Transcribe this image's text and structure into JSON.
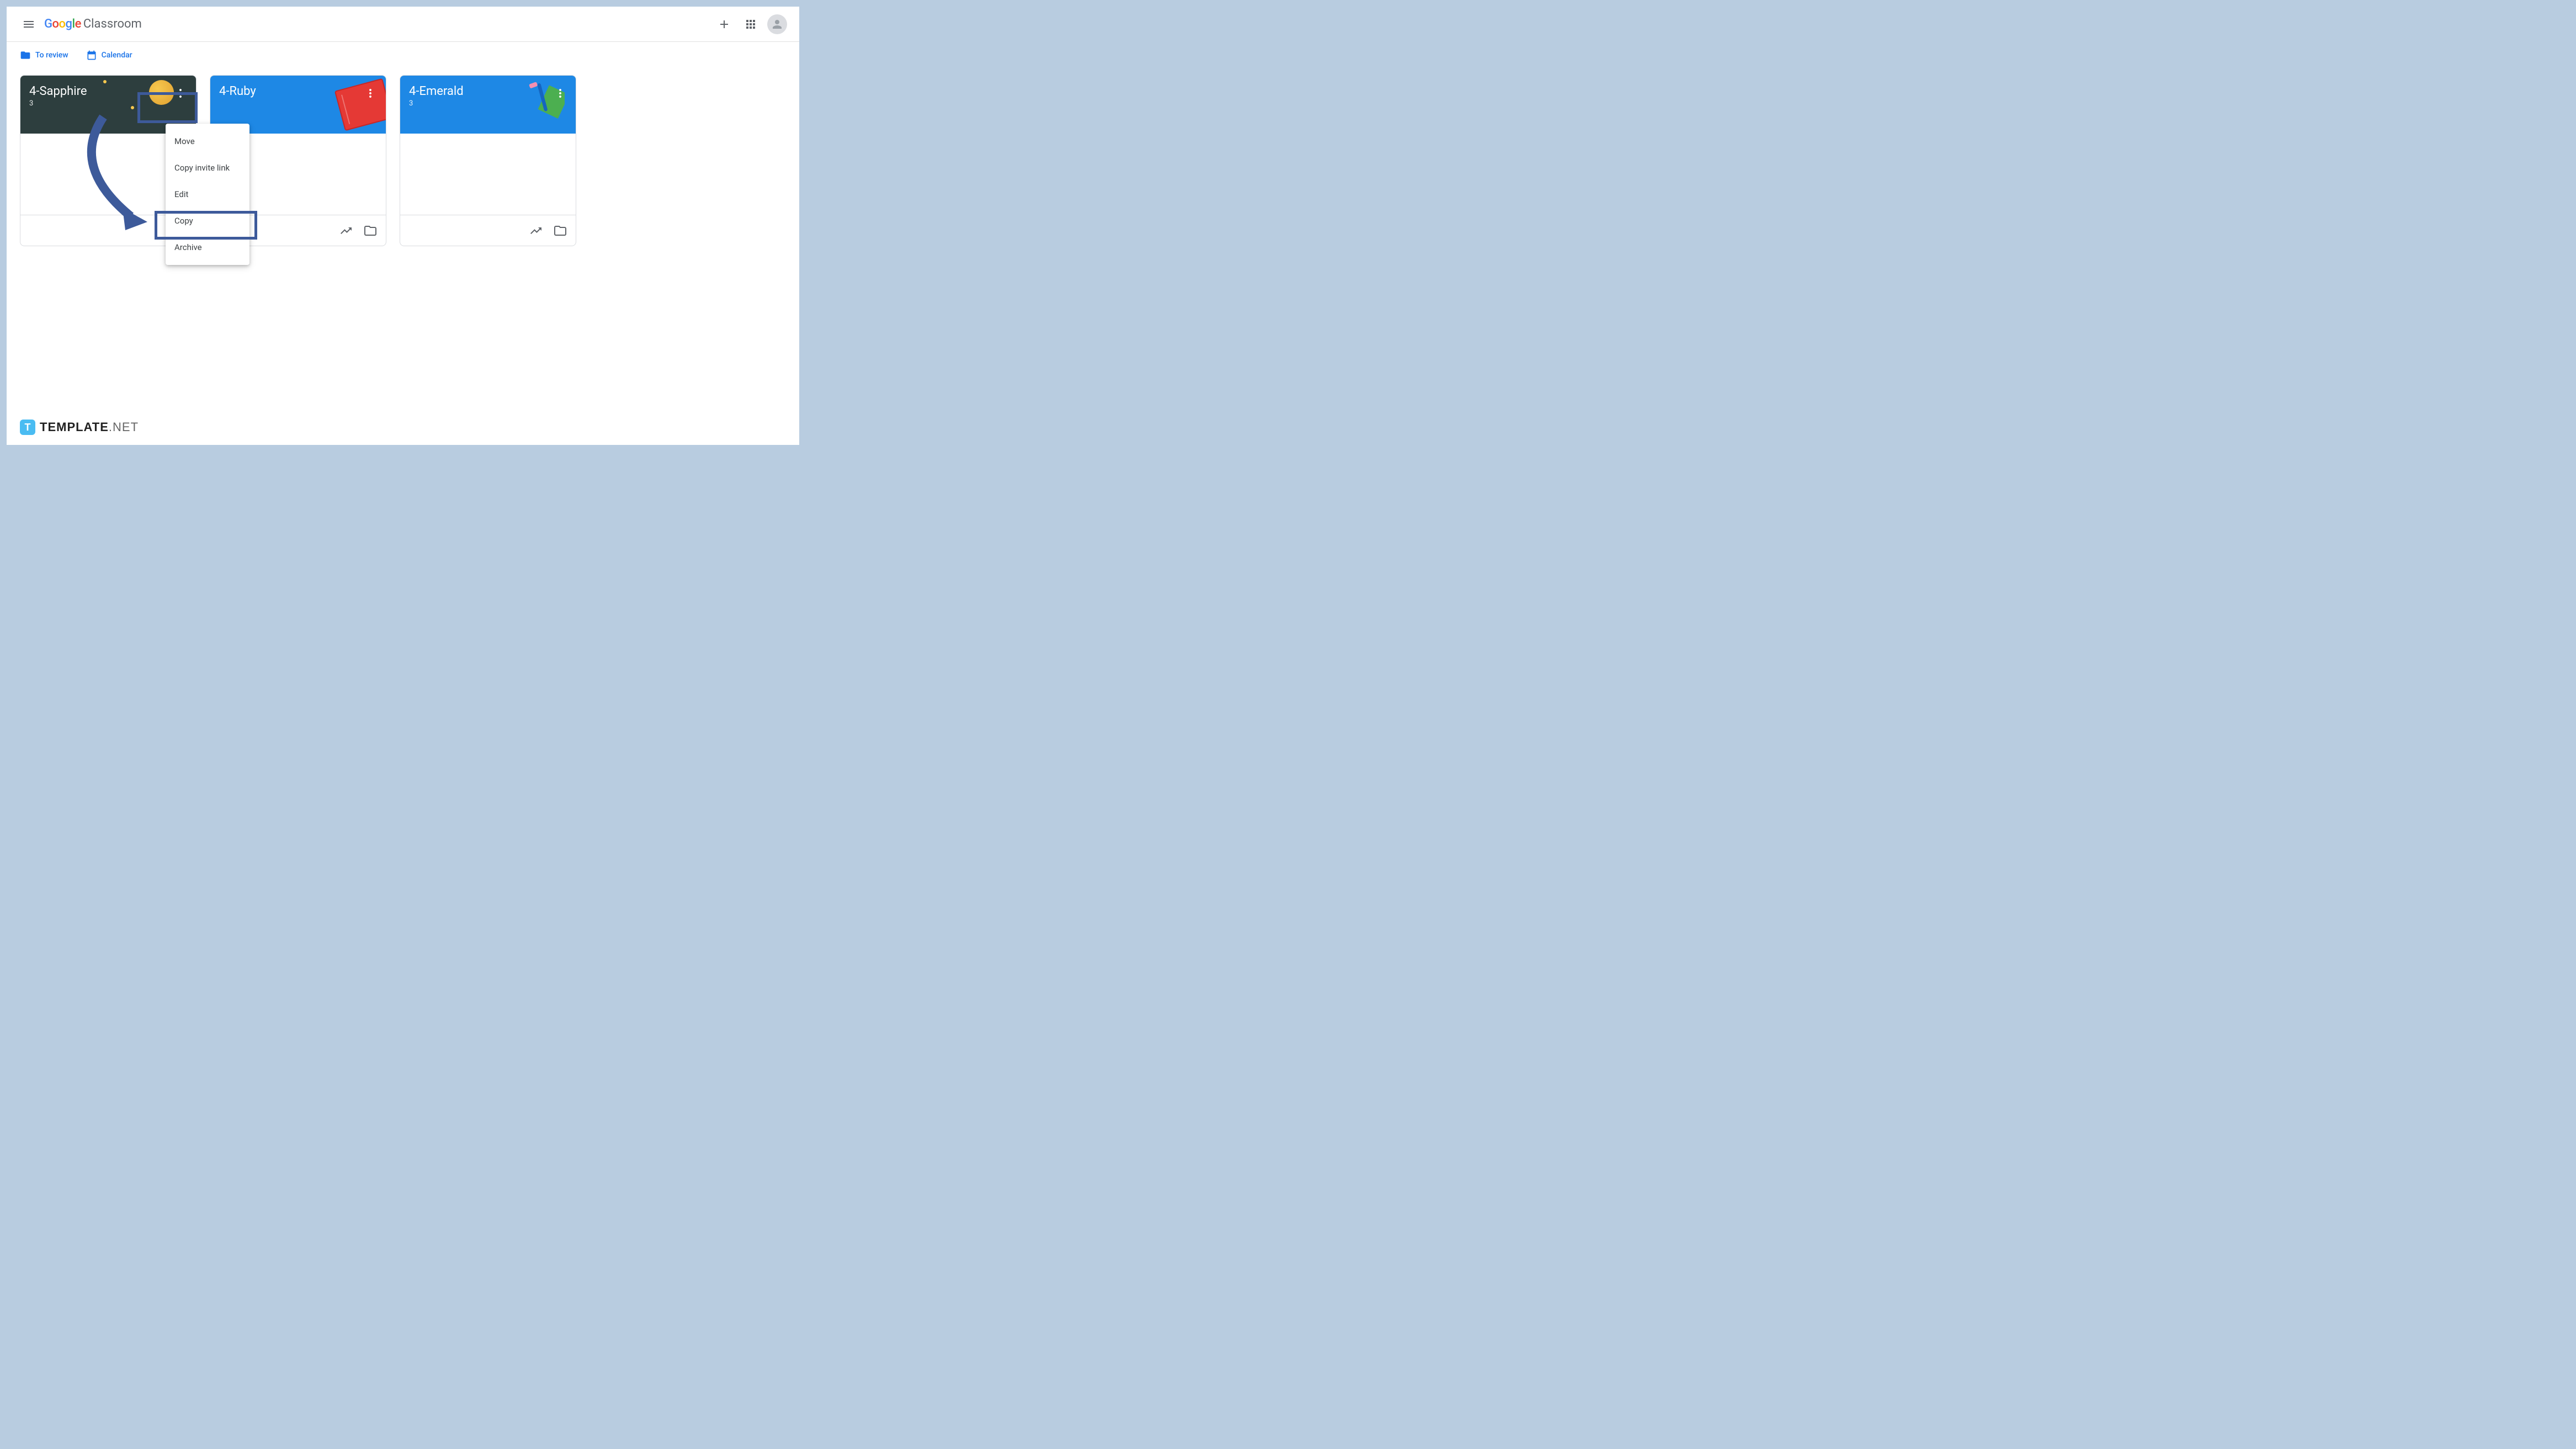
{
  "header": {
    "brand_google": "Google",
    "brand_classroom": "Classroom"
  },
  "subheader": {
    "to_review": "To review",
    "calendar": "Calendar"
  },
  "cards": [
    {
      "title": "4-Sapphire",
      "subtitle": "3"
    },
    {
      "title": "4-Ruby",
      "subtitle": ""
    },
    {
      "title": "4-Emerald",
      "subtitle": "3"
    }
  ],
  "menu": {
    "move": "Move",
    "copy_invite": "Copy invite link",
    "edit": "Edit",
    "copy": "Copy",
    "archive": "Archive"
  },
  "watermark": {
    "icon_letter": "T",
    "brand_bold": "TEMPLATE",
    "brand_light": ".NET"
  }
}
